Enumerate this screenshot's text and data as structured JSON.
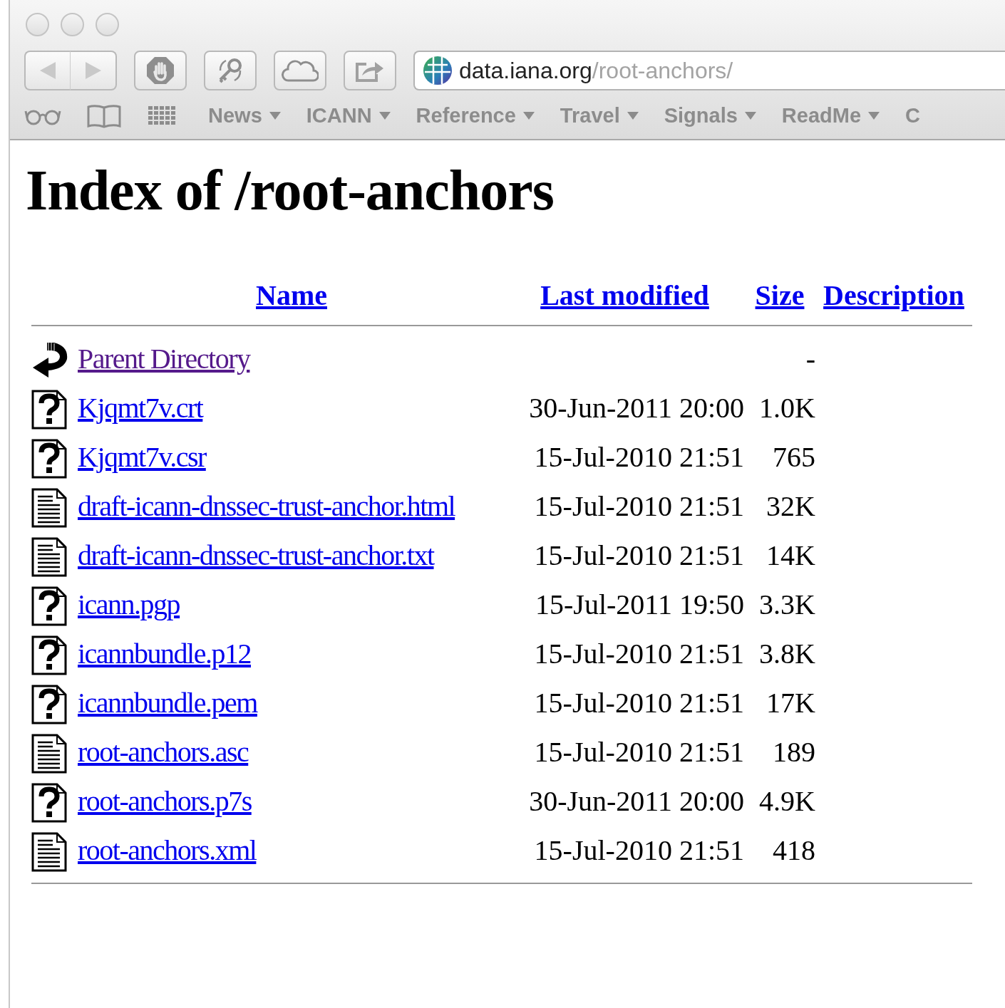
{
  "address_bar": {
    "host": "data.iana.org",
    "path": "/root-anchors/"
  },
  "bookmarks": [
    {
      "label": "News",
      "kind": "menu"
    },
    {
      "label": "ICANN",
      "kind": "menu"
    },
    {
      "label": "Reference",
      "kind": "menu"
    },
    {
      "label": "Travel",
      "kind": "menu"
    },
    {
      "label": "Signals",
      "kind": "menu"
    },
    {
      "label": "ReadMe",
      "kind": "menu"
    },
    {
      "label": "C",
      "kind": "link"
    }
  ],
  "page": {
    "title": "Index of /root-anchors",
    "columns": [
      "Name",
      "Last modified",
      "Size",
      "Description"
    ],
    "rows": [
      {
        "kind": "back",
        "name": "Parent Directory",
        "visited": true,
        "last_modified": "",
        "size": "-"
      },
      {
        "kind": "unknown",
        "name": "Kjqmt7v.crt",
        "visited": false,
        "last_modified": "30-Jun-2011 20:00",
        "size": "1.0K"
      },
      {
        "kind": "unknown",
        "name": "Kjqmt7v.csr",
        "visited": false,
        "last_modified": "15-Jul-2010 21:51",
        "size": "765"
      },
      {
        "kind": "text",
        "name": "draft-icann-dnssec-trust-anchor.html",
        "visited": false,
        "last_modified": "15-Jul-2010 21:51",
        "size": "32K"
      },
      {
        "kind": "text",
        "name": "draft-icann-dnssec-trust-anchor.txt",
        "visited": false,
        "last_modified": "15-Jul-2010 21:51",
        "size": "14K"
      },
      {
        "kind": "unknown",
        "name": "icann.pgp",
        "visited": false,
        "last_modified": "15-Jul-2011 19:50",
        "size": "3.3K"
      },
      {
        "kind": "unknown",
        "name": "icannbundle.p12",
        "visited": false,
        "last_modified": "15-Jul-2010 21:51",
        "size": "3.8K"
      },
      {
        "kind": "unknown",
        "name": "icannbundle.pem",
        "visited": false,
        "last_modified": "15-Jul-2010 21:51",
        "size": "17K"
      },
      {
        "kind": "text",
        "name": "root-anchors.asc",
        "visited": false,
        "last_modified": "15-Jul-2010 21:51",
        "size": "189"
      },
      {
        "kind": "unknown",
        "name": "root-anchors.p7s",
        "visited": false,
        "last_modified": "30-Jun-2011 20:00",
        "size": "4.9K"
      },
      {
        "kind": "text",
        "name": "root-anchors.xml",
        "visited": false,
        "last_modified": "15-Jul-2010 21:51",
        "size": "418"
      }
    ]
  }
}
